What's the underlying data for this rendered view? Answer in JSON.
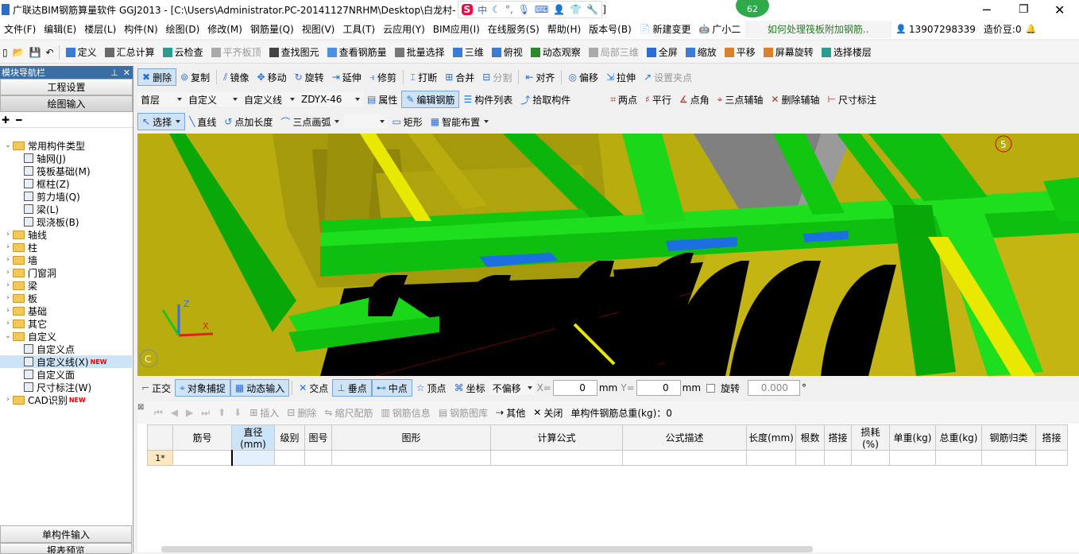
{
  "titlebar": {
    "title": "广联达BIM钢筋算量软件 GGJ2013 - [C:\\Users\\Administrator.PC-20141127NRHM\\Desktop\\白龙村-",
    "title_tail": "]",
    "badge": "62"
  },
  "menu": [
    "文件(F)",
    "编辑(E)",
    "楼层(L)",
    "构件(N)",
    "绘图(D)",
    "修改(M)",
    "钢筋量(Q)",
    "视图(V)",
    "工具(T)",
    "云应用(Y)",
    "BIM应用(I)",
    "在线服务(S)",
    "帮助(H)",
    "版本号(B)"
  ],
  "menu_right": {
    "change": "新建变更",
    "guang": "广小二",
    "question": "如何处理筏板附加钢筋..",
    "phone": "13907298339",
    "coins": "造价豆:0"
  },
  "toolbar1": [
    "定义",
    "汇总计算",
    "云检查",
    "平齐板顶",
    "查找图元",
    "查看钢筋量",
    "批量选择",
    "三维",
    "俯视",
    "动态观察",
    "局部三维",
    "全屏",
    "缩放",
    "平移",
    "屏幕旋转",
    "选择楼层"
  ],
  "nav": {
    "header": "模块导航栏",
    "btn_project": "工程设置",
    "btn_draw": "绘图输入",
    "tree": [
      {
        "label": "常用构件类型",
        "level": 0,
        "exp": "⌄"
      },
      {
        "label": "轴网(J)",
        "level": 1
      },
      {
        "label": "筏板基础(M)",
        "level": 1
      },
      {
        "label": "框柱(Z)",
        "level": 1
      },
      {
        "label": "剪力墙(Q)",
        "level": 1
      },
      {
        "label": "梁(L)",
        "level": 1
      },
      {
        "label": "现浇板(B)",
        "level": 1
      },
      {
        "label": "轴线",
        "level": 0,
        "exp": "›"
      },
      {
        "label": "柱",
        "level": 0,
        "exp": "›"
      },
      {
        "label": "墙",
        "level": 0,
        "exp": "›"
      },
      {
        "label": "门窗洞",
        "level": 0,
        "exp": "›"
      },
      {
        "label": "梁",
        "level": 0,
        "exp": "›"
      },
      {
        "label": "板",
        "level": 0,
        "exp": "›"
      },
      {
        "label": "基础",
        "level": 0,
        "exp": "›"
      },
      {
        "label": "其它",
        "level": 0,
        "exp": "›"
      },
      {
        "label": "自定义",
        "level": 0,
        "exp": "⌄"
      },
      {
        "label": "自定义点",
        "level": 1
      },
      {
        "label": "自定义线(X)",
        "level": 1,
        "new": "NEW"
      },
      {
        "label": "自定义面",
        "level": 1
      },
      {
        "label": "尺寸标注(W)",
        "level": 1
      },
      {
        "label": "CAD识别",
        "level": 0,
        "exp": "›",
        "new": "NEW"
      }
    ],
    "bottom1": "单构件输入",
    "bottom2": "报表预览"
  },
  "edit_toolbar": [
    "删除",
    "复制",
    "镜像",
    "移动",
    "旋转",
    "延伸",
    "修剪",
    "打断",
    "合并",
    "分割",
    "对齐",
    "偏移",
    "拉伸",
    "设置夹点"
  ],
  "combos": {
    "floor": "首层",
    "type": "自定义",
    "sub": "自定义线",
    "name": "ZDYX-46"
  },
  "prop_toolbar": [
    "属性",
    "编辑钢筋",
    "构件列表",
    "拾取构件"
  ],
  "axis_toolbar": [
    "两点",
    "平行",
    "点角",
    "三点辅轴",
    "删除辅轴",
    "尺寸标注"
  ],
  "draw_toolbar": [
    "选择",
    "直线",
    "点加长度",
    "三点画弧",
    "矩形",
    "智能布置"
  ],
  "view_labels": {
    "axis5": "5",
    "axisC": "C"
  },
  "snap": {
    "items": [
      "正交",
      "对象捕捉",
      "动态输入",
      "交点",
      "垂点",
      "中点",
      "顶点",
      "坐标"
    ],
    "offset": "不偏移",
    "x_label": "X=",
    "x_val": "0",
    "y_label": "Y=",
    "y_val": "0",
    "mm": "mm",
    "rotate": "旋转",
    "rot_val": "0.000",
    "deg": "°"
  },
  "rebar_toolbar": {
    "items": [
      "插入",
      "删除",
      "缩尺配筋",
      "钢筋信息",
      "钢筋图库",
      "其他",
      "关闭"
    ],
    "total": "单构件钢筋总重(kg)：0"
  },
  "table": {
    "headers": [
      "筋号",
      "直径(mm)",
      "级别",
      "图号",
      "图形",
      "计算公式",
      "公式描述",
      "长度(mm)",
      "根数",
      "搭接",
      "损耗(%)",
      "单重(kg)",
      "总重(kg)",
      "钢筋归类",
      "搭接"
    ],
    "row_label": "1*"
  }
}
